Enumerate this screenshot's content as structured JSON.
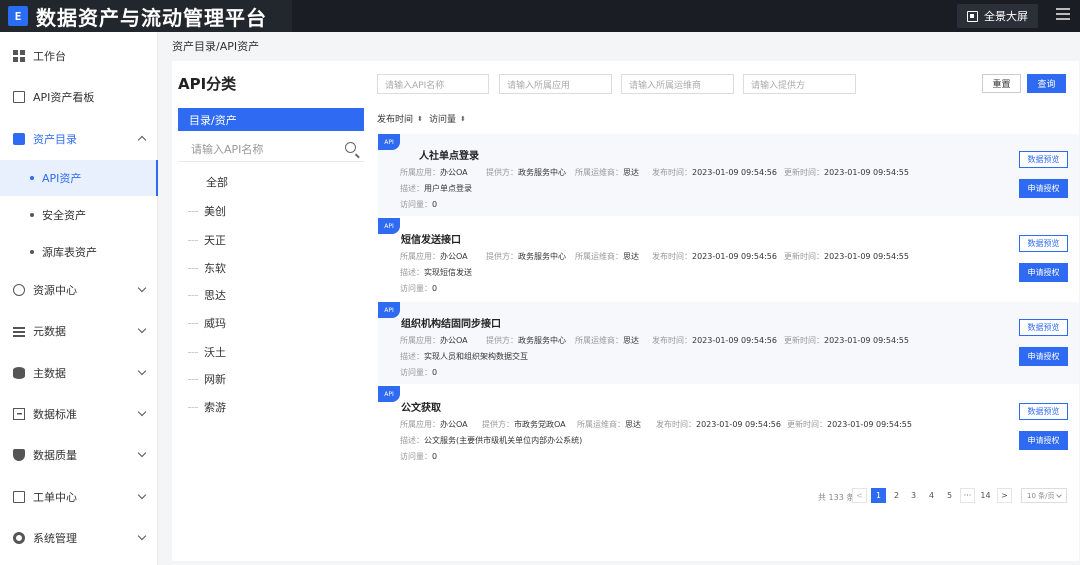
{
  "app": {
    "logo_text": "E",
    "title": "数据资产与流动管理平台",
    "fullscreen_label": "全景大屏"
  },
  "sidebar": {
    "items": [
      {
        "label": "工作台"
      },
      {
        "label": "API资产看板"
      },
      {
        "label": "资产目录"
      },
      {
        "label": "资源中心"
      },
      {
        "label": "元数据"
      },
      {
        "label": "主数据"
      },
      {
        "label": "数据标准"
      },
      {
        "label": "数据质量"
      },
      {
        "label": "工单中心"
      },
      {
        "label": "系统管理"
      }
    ],
    "sub_items": [
      {
        "label": "API资产"
      },
      {
        "label": "安全资产"
      },
      {
        "label": "源库表资产"
      }
    ]
  },
  "breadcrumb": "资产目录/API资产",
  "category": {
    "title": "API分类",
    "tab": "目录/资产",
    "search_placeholder": "请输入API名称",
    "all_label": "全部",
    "nodes": [
      "美创",
      "天正",
      "东软",
      "思达",
      "威玛",
      "沃土",
      "网新",
      "索游"
    ]
  },
  "filters": {
    "api_name_placeholder": "请输入API名称",
    "app_placeholder": "请输入所属应用",
    "vendor_placeholder": "请输入所属运维商",
    "provider_placeholder": "请输入提供方",
    "reset_label": "重置",
    "query_label": "查询"
  },
  "sort": {
    "publish_time": "发布时间",
    "visits": "访问量",
    "arrows": "⬍"
  },
  "labels": {
    "badge": "API",
    "app": "所属应用：",
    "provider": "提供方：",
    "vendor": "所属运维商：",
    "publish": "发布时间：",
    "update": "更新时间：",
    "desc": "描述：",
    "visits": "访问量：",
    "preview_btn": "数据预览",
    "apply_btn": "申请授权"
  },
  "cards": [
    {
      "title": "人社单点登录",
      "app": "办公OA",
      "provider": "政务服务中心",
      "vendor": "思达",
      "publish": "2023-01-09 09:54:56",
      "update": "2023-01-09 09:54:55",
      "desc": "用户单点登录",
      "visits": "0"
    },
    {
      "title": "短信发送接口",
      "app": "办公OA",
      "provider": "政务服务中心",
      "vendor": "思达",
      "publish": "2023-01-09 09:54:56",
      "update": "2023-01-09 09:54:55",
      "desc": "实现短信发送",
      "visits": "0"
    },
    {
      "title": "组织机构结固同步接口",
      "app": "办公OA",
      "provider": "政务服务中心",
      "vendor": "思达",
      "publish": "2023-01-09 09:54:56",
      "update": "2023-01-09 09:54:55",
      "desc": "实现人员和组织架构数据交互",
      "visits": "0"
    },
    {
      "title": "公文获取",
      "app": "办公OA",
      "provider": "市政务党政OA",
      "vendor": "思达",
      "publish": "2023-01-09 09:54:56",
      "update": "2023-01-09 09:54:55",
      "desc": "公文服务(主要供市级机关单位内部办公系统)",
      "visits": "0"
    }
  ],
  "pagination": {
    "total": "共 133 条",
    "prev": "<",
    "next": ">",
    "pages": [
      "1",
      "2",
      "3",
      "4",
      "5",
      "···",
      "14"
    ],
    "current": "1",
    "page_size": "10 条/页"
  },
  "colors": {
    "accent": "#2f6bf2",
    "header_bg": "#1a1d23"
  }
}
